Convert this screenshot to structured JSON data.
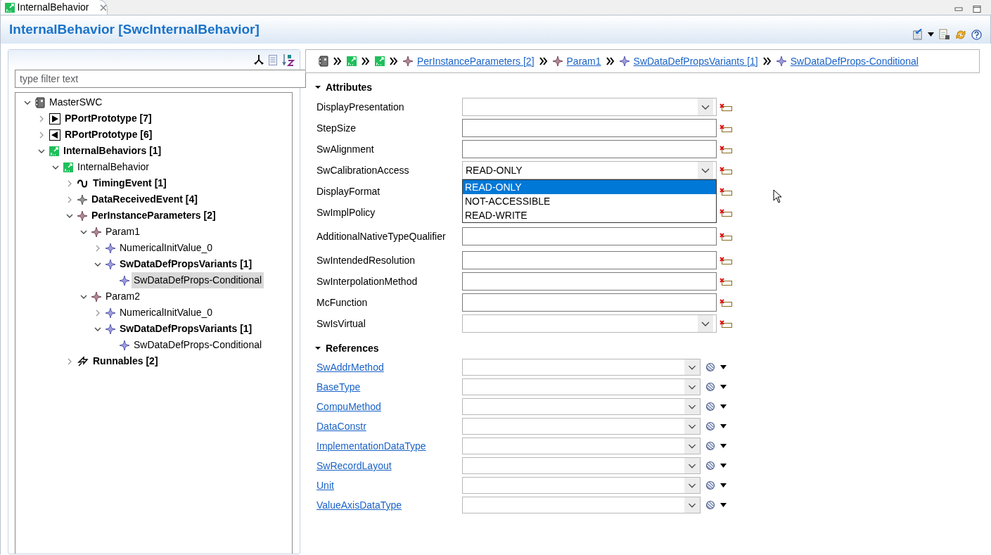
{
  "tab": {
    "title": "InternalBehavior"
  },
  "editor": {
    "title": "InternalBehavior [SwcInternalBehavior]"
  },
  "outline": {
    "filter_placeholder": "type filter text",
    "tree": [
      {
        "label": "MasterSWC",
        "kind": "component",
        "bold": false,
        "expanded": true,
        "selected": false,
        "children": [
          {
            "label": "PPortPrototype [7]",
            "kind": "pport",
            "bold": true,
            "expanded": false,
            "selected": false
          },
          {
            "label": "RPortPrototype [6]",
            "kind": "rport",
            "bold": true,
            "expanded": false,
            "selected": false
          },
          {
            "label": "InternalBehaviors [1]",
            "kind": "behavior",
            "bold": true,
            "expanded": true,
            "selected": false,
            "children": [
              {
                "label": "InternalBehavior",
                "kind": "behavior",
                "bold": false,
                "expanded": true,
                "selected": false,
                "children": [
                  {
                    "label": "TimingEvent [1]",
                    "kind": "timing",
                    "bold": true,
                    "expanded": false,
                    "selected": false
                  },
                  {
                    "label": "DataReceivedEvent [4]",
                    "kind": "event",
                    "bold": true,
                    "expanded": false,
                    "selected": false
                  },
                  {
                    "label": "PerInstanceParameters [2]",
                    "kind": "param",
                    "bold": true,
                    "expanded": true,
                    "selected": false,
                    "children": [
                      {
                        "label": "Param1",
                        "kind": "param",
                        "bold": false,
                        "expanded": true,
                        "selected": false,
                        "children": [
                          {
                            "label": "NumericalInitValue_0",
                            "kind": "variant",
                            "bold": false,
                            "expanded": false,
                            "selected": false
                          },
                          {
                            "label": "SwDataDefPropsVariants [1]",
                            "kind": "variant",
                            "bold": true,
                            "expanded": true,
                            "selected": false,
                            "children": [
                              {
                                "label": "SwDataDefProps-Conditional",
                                "kind": "variant",
                                "bold": false,
                                "selected": true
                              }
                            ]
                          }
                        ]
                      },
                      {
                        "label": "Param2",
                        "kind": "param",
                        "bold": false,
                        "expanded": true,
                        "selected": false,
                        "children": [
                          {
                            "label": "NumericalInitValue_0",
                            "kind": "variant",
                            "bold": false,
                            "expanded": false,
                            "selected": false
                          },
                          {
                            "label": "SwDataDefPropsVariants [1]",
                            "kind": "variant",
                            "bold": true,
                            "expanded": true,
                            "selected": false,
                            "children": [
                              {
                                "label": "SwDataDefProps-Conditional",
                                "kind": "variant",
                                "bold": false,
                                "selected": false
                              }
                            ]
                          }
                        ]
                      }
                    ]
                  },
                  {
                    "label": "Runnables [2]",
                    "kind": "runnable",
                    "bold": true,
                    "expanded": false,
                    "selected": false
                  }
                ]
              }
            ]
          }
        ]
      }
    ]
  },
  "breadcrumb": [
    {
      "kind": "component"
    },
    {
      "kind": "behavior"
    },
    {
      "kind": "behavior"
    },
    {
      "kind": "param",
      "label": "PerInstanceParameters [2]"
    },
    {
      "kind": "param",
      "label": "Param1"
    },
    {
      "kind": "variant",
      "label": "SwDataDefPropsVariants [1]"
    },
    {
      "kind": "variant",
      "label": "SwDataDefProps-Conditional"
    }
  ],
  "attributes": {
    "title": "Attributes",
    "expanded": true,
    "fields": [
      {
        "label": "DisplayPresentation",
        "kind": "combo"
      },
      {
        "label": "StepSize",
        "kind": "text"
      },
      {
        "label": "SwAlignment",
        "kind": "text"
      },
      {
        "label": "SwCalibrationAccess",
        "kind": "combo",
        "value": "READ-ONLY",
        "open": true,
        "options": [
          {
            "label": "READ-ONLY",
            "selected": true
          },
          {
            "label": "NOT-ACCESSIBLE",
            "selected": false
          },
          {
            "label": "READ-WRITE",
            "selected": false
          }
        ]
      },
      {
        "label": "DisplayFormat"
      },
      {
        "label": "SwImplPolicy"
      },
      {
        "label": "AdditionalNativeTypeQualifier",
        "kind": "text"
      },
      {
        "label": "SwIntendedResolution",
        "kind": "text"
      },
      {
        "label": "SwInterpolationMethod",
        "kind": "text"
      },
      {
        "label": "McFunction",
        "kind": "text"
      },
      {
        "label": "SwIsVirtual",
        "kind": "combo"
      }
    ]
  },
  "references": {
    "title": "References",
    "expanded": true,
    "fields": [
      {
        "label": "SwAddrMethod"
      },
      {
        "label": "BaseType"
      },
      {
        "label": "CompuMethod"
      },
      {
        "label": "DataConstr"
      },
      {
        "label": "ImplementationDataType"
      },
      {
        "label": "SwRecordLayout"
      },
      {
        "label": "Unit"
      },
      {
        "label": "ValueAxisDataType"
      }
    ]
  }
}
